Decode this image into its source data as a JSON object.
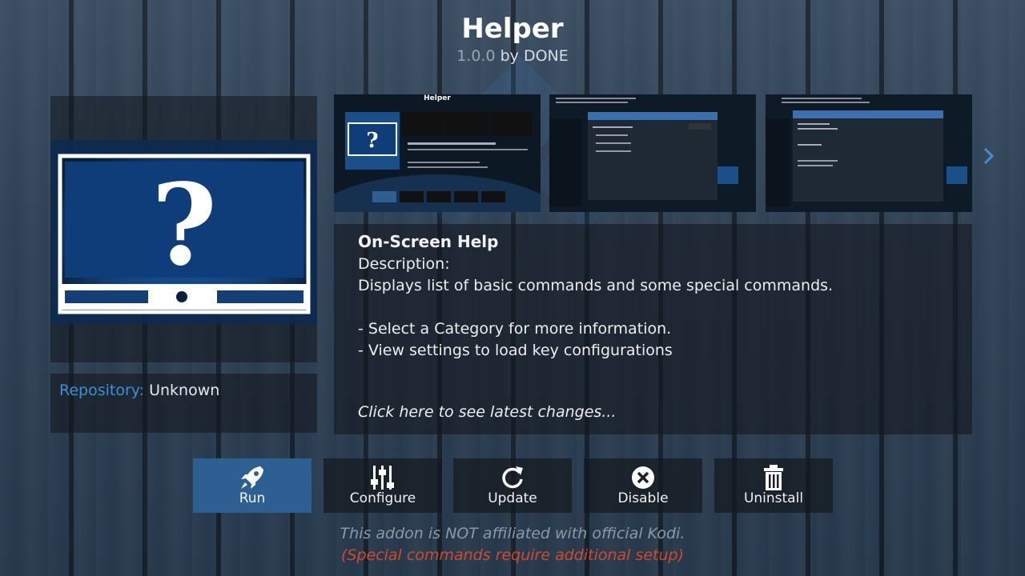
{
  "addon": {
    "name": "Helper",
    "version": "1.0.0",
    "by_label": "by DONE"
  },
  "repository": {
    "label": "Repository:",
    "value": "Unknown"
  },
  "screenshots": {
    "shot1_title": "Helper"
  },
  "description": {
    "title": "On-Screen Help",
    "body": "Description:\nDisplays list of basic commands and some special commands.\n\n- Select a Category for more information.\n- View settings to load key configurations",
    "changes_link": "Click here to see latest changes..."
  },
  "buttons": [
    {
      "label": "Run",
      "icon": "rocket-icon"
    },
    {
      "label": "Configure",
      "icon": "sliders-icon"
    },
    {
      "label": "Update",
      "icon": "refresh-icon"
    },
    {
      "label": "Disable",
      "icon": "disable-x-icon"
    },
    {
      "label": "Uninstall",
      "icon": "trash-icon"
    }
  ],
  "footer": {
    "line1": "This addon is NOT affiliated with official Kodi.",
    "line2": "(Special commands require additional setup)"
  },
  "colors": {
    "accent": "#2d5f93",
    "repository_label": "#3f8fd6",
    "warning": "#d24a2c"
  }
}
